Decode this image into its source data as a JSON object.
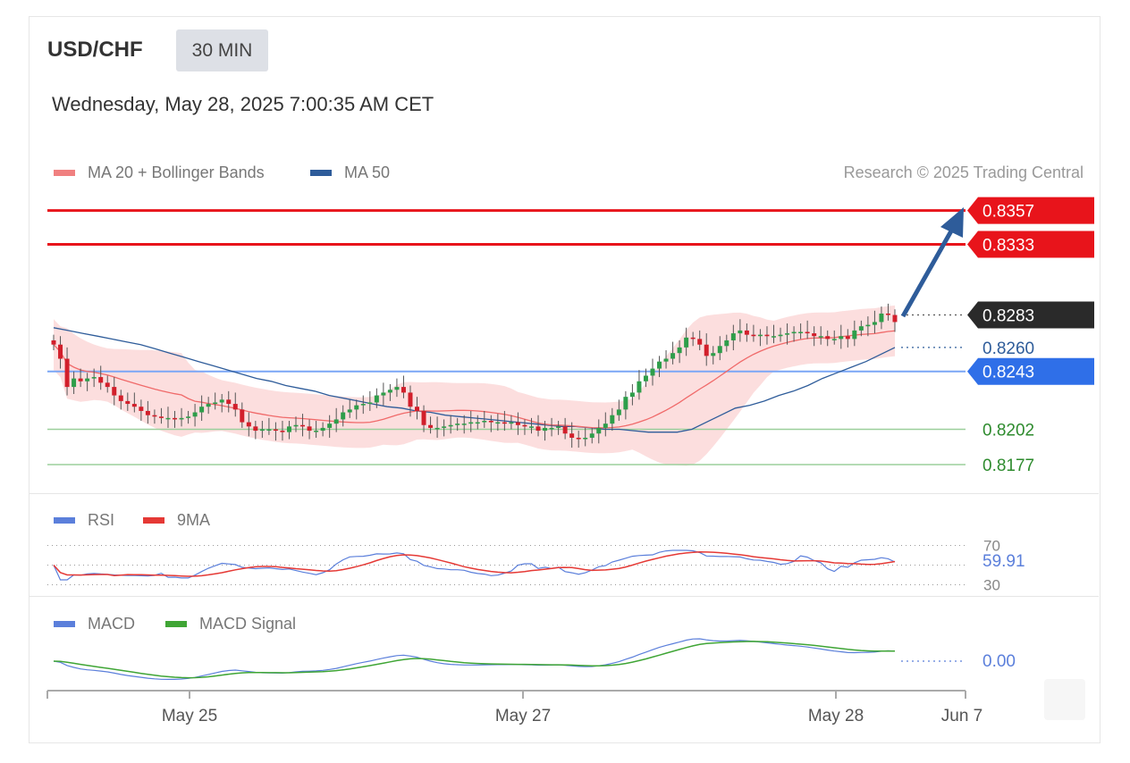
{
  "header": {
    "symbol": "USD/CHF",
    "timeframe": "30 MIN",
    "datetime": "Wednesday, May 28, 2025 7:00:35 AM CET"
  },
  "legend_main": {
    "ma20_label": "MA 20 + Bollinger Bands",
    "ma20_color": "#f08080",
    "ma50_label": "MA 50",
    "ma50_color": "#2e5c9a"
  },
  "credit": "Research © 2025 Trading Central",
  "legend_rsi": {
    "rsi_label": "RSI",
    "rsi_color": "#5b7fdb",
    "ma_label": "9MA",
    "ma_color": "#e53935"
  },
  "legend_macd": {
    "macd_label": "MACD",
    "macd_color": "#5b7fdb",
    "signal_label": "MACD Signal",
    "signal_color": "#3fa535"
  },
  "chart_data": {
    "type": "candlestick",
    "ylim": [
      0.8158,
      0.8365
    ],
    "levels": [
      {
        "value": 0.8357,
        "label": "0.8357",
        "kind": "resistance",
        "color": "#e8141b"
      },
      {
        "value": 0.8333,
        "label": "0.8333",
        "kind": "resistance",
        "color": "#e8141b"
      },
      {
        "value": 0.8283,
        "label": "0.8283",
        "kind": "last-price",
        "color": "#2a2a2a"
      },
      {
        "value": 0.826,
        "label": "0.8260",
        "kind": "ma50",
        "color": "#2e5c9a"
      },
      {
        "value": 0.8243,
        "label": "0.8243",
        "kind": "pivot",
        "color": "#2f6fe8"
      },
      {
        "value": 0.8202,
        "label": "0.8202",
        "kind": "support",
        "color": "#2e8b2e"
      },
      {
        "value": 0.8177,
        "label": "0.8177",
        "kind": "support",
        "color": "#2e8b2e"
      }
    ],
    "xaxis": {
      "ticks": [
        "May 25",
        "May 27",
        "May 28",
        "Jun 7"
      ]
    },
    "close": [
      0.8262,
      0.8252,
      0.8232,
      0.8238,
      0.8236,
      0.8238,
      0.8239,
      0.8235,
      0.8232,
      0.8226,
      0.8222,
      0.822,
      0.8218,
      0.8215,
      0.8212,
      0.8211,
      0.821,
      0.821,
      0.8209,
      0.821,
      0.8211,
      0.8214,
      0.8218,
      0.822,
      0.8221,
      0.8223,
      0.822,
      0.8216,
      0.8207,
      0.8204,
      0.8201,
      0.8202,
      0.8202,
      0.8201,
      0.82,
      0.8204,
      0.8205,
      0.8204,
      0.8201,
      0.8201,
      0.8203,
      0.8206,
      0.8209,
      0.8214,
      0.8216,
      0.8219,
      0.822,
      0.8221,
      0.8226,
      0.8228,
      0.823,
      0.8232,
      0.8228,
      0.8218,
      0.8215,
      0.8205,
      0.8203,
      0.8203,
      0.8204,
      0.8205,
      0.8206,
      0.8206,
      0.8207,
      0.8207,
      0.8208,
      0.8207,
      0.8207,
      0.8206,
      0.8207,
      0.8205,
      0.8204,
      0.8204,
      0.8201,
      0.8203,
      0.8203,
      0.8204,
      0.8199,
      0.8196,
      0.8195,
      0.8196,
      0.8199,
      0.8203,
      0.8206,
      0.8212,
      0.8216,
      0.8225,
      0.8228,
      0.8236,
      0.824,
      0.8245,
      0.825,
      0.8252,
      0.8256,
      0.826,
      0.8267,
      0.8266,
      0.8262,
      0.8254,
      0.8256,
      0.8261,
      0.8265,
      0.827,
      0.8272,
      0.8269,
      0.8268,
      0.8269,
      0.8268,
      0.8268,
      0.8269,
      0.827,
      0.8271,
      0.8271,
      0.827,
      0.8268,
      0.8268,
      0.8266,
      0.8266,
      0.8268,
      0.8266,
      0.8272,
      0.8275,
      0.8276,
      0.8278,
      0.8284,
      0.8283,
      0.8278
    ],
    "ma50": [
      0.8274,
      0.8272,
      0.827,
      0.8268,
      0.8266,
      0.8264,
      0.8262,
      0.8259,
      0.8256,
      0.8253,
      0.825,
      0.8247,
      0.8244,
      0.8241,
      0.8238,
      0.8236,
      0.8233,
      0.8231,
      0.8229,
      0.8226,
      0.8224,
      0.8222,
      0.822,
      0.8218,
      0.8217,
      0.8215,
      0.8214,
      0.8212,
      0.8211,
      0.821,
      0.8209,
      0.8208,
      0.8207,
      0.8206,
      0.8205,
      0.8204,
      0.8204,
      0.8203,
      0.8202,
      0.8202,
      0.8201,
      0.82,
      0.82,
      0.82,
      0.8202,
      0.8207,
      0.8212,
      0.8217,
      0.8219,
      0.8222,
      0.8226,
      0.8229,
      0.8233,
      0.8238,
      0.8242,
      0.8246,
      0.825,
      0.8255,
      0.826
    ],
    "rsi": {
      "last": "59.91",
      "labels": [
        "70",
        "30"
      ]
    },
    "macd": {
      "last": "0.00"
    }
  }
}
